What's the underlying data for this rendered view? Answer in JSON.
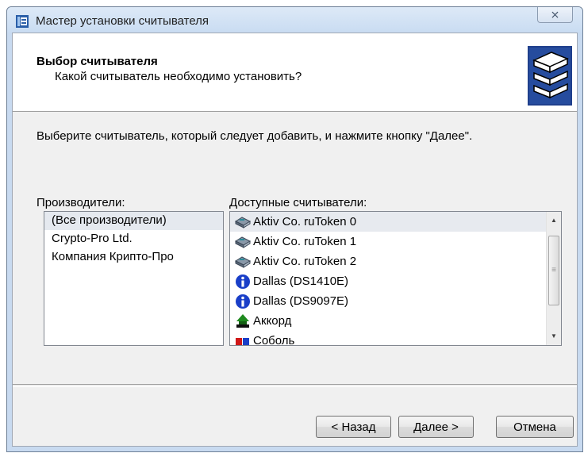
{
  "window": {
    "title": "Мастер установки считывателя",
    "close_symbol": "⨯"
  },
  "header": {
    "title": "Выбор считывателя",
    "subtitle": "Какой считыватель необходимо установить?"
  },
  "instruction": "Выберите считыватель, который следует добавить, и нажмите кнопку \"Далее\".",
  "manufacturers": {
    "label": "Производители:",
    "items": [
      "(Все производители)",
      "Crypto-Pro Ltd.",
      "Компания Крипто-Про"
    ],
    "selected_index": 0
  },
  "readers": {
    "label": "Доступные считыватели:",
    "items": [
      {
        "label": "Aktiv Co. ruToken 0",
        "icon": "token-reader-icon"
      },
      {
        "label": "Aktiv Co. ruToken 1",
        "icon": "token-reader-icon"
      },
      {
        "label": "Aktiv Co. ruToken 2",
        "icon": "token-reader-icon"
      },
      {
        "label": "Dallas (DS1410E)",
        "icon": "info-icon"
      },
      {
        "label": "Dallas (DS9097E)",
        "icon": "info-icon"
      },
      {
        "label": "Аккорд",
        "icon": "accord-icon"
      },
      {
        "label": "Соболь",
        "icon": "sobol-icon"
      }
    ],
    "selected_index": 0
  },
  "buttons": {
    "back": "< Назад",
    "next": "Далее >",
    "cancel": "Отмена"
  },
  "colors": {
    "titlebar": "#c9dcf2",
    "info_icon": "#1a3fc8",
    "accord_icon": "#1f8a1f",
    "sobol_icon_red": "#d01818",
    "sobol_icon_blue": "#1a3fc8"
  }
}
